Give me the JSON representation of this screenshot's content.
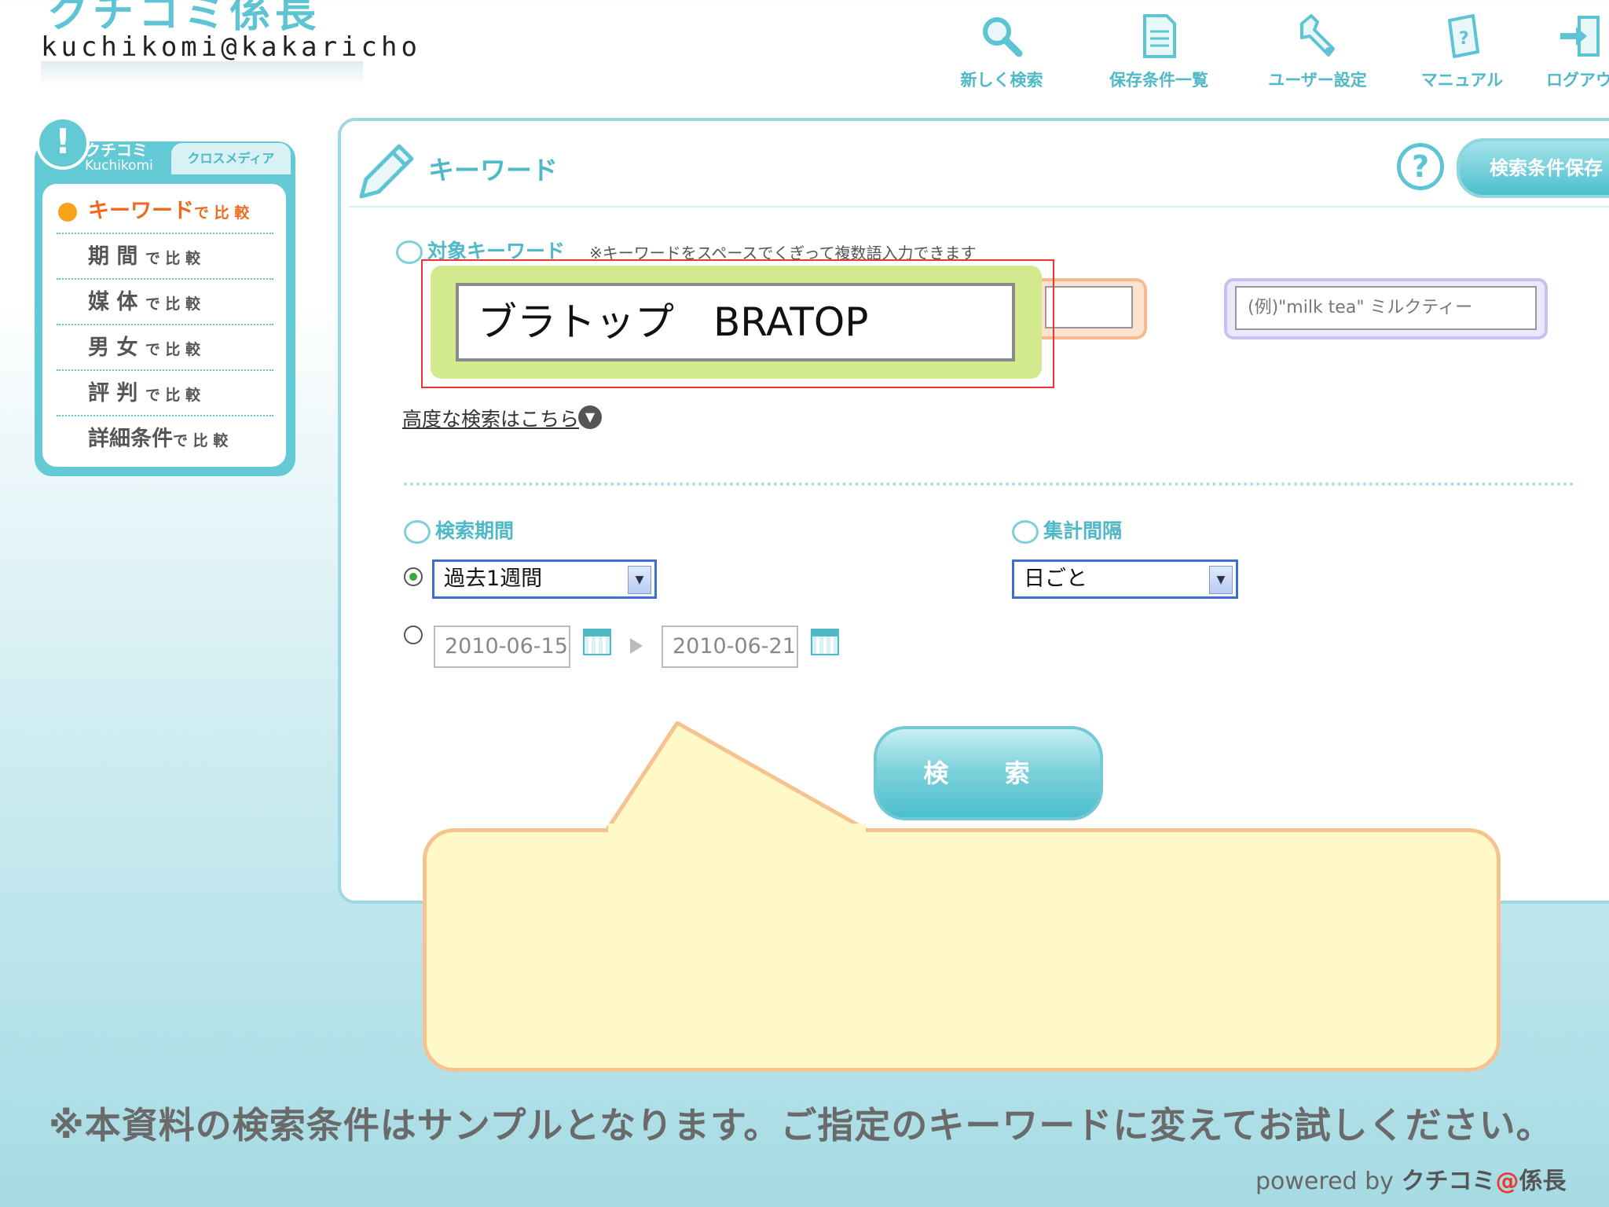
{
  "logo": {
    "title": "クチコミ係長",
    "subtitle": "kuchikomi@kakaricho"
  },
  "nav": [
    {
      "label": "新しく検索",
      "icon": "search-icon"
    },
    {
      "label": "保存条件一覧",
      "icon": "document-icon"
    },
    {
      "label": "ユーザー設定",
      "icon": "wrench-icon"
    },
    {
      "label": "マニュアル",
      "icon": "manual-icon"
    },
    {
      "label": "ログアウ",
      "icon": "logout-icon"
    }
  ],
  "sidebar": {
    "badge": "!",
    "title": "クチコミ",
    "title_en": "Kuchikomi",
    "tab": "クロスメディア",
    "items": [
      {
        "main": "キーワード",
        "suffix": "で 比 較",
        "active": true
      },
      {
        "main": "期 間",
        "suffix": "で 比 較",
        "active": false
      },
      {
        "main": "媒 体",
        "suffix": "で 比 較",
        "active": false
      },
      {
        "main": "男 女",
        "suffix": "で 比 較",
        "active": false
      },
      {
        "main": "評 判",
        "suffix": "で 比 較",
        "active": false
      },
      {
        "main": "詳細条件",
        "suffix": "で 比 較",
        "active": false
      }
    ]
  },
  "panel": {
    "title": "キーワード",
    "help": "?",
    "save_button": "検索条件保存"
  },
  "keyword": {
    "label": "対象キーワード",
    "note": "※キーワードをスペースでくぎって複数語入力できます",
    "value": "ブラトップ　BRATOP",
    "second_value": "",
    "placeholder": "(例)\"milk tea\" ミルクティー"
  },
  "advanced_link": "高度な検索はこちら",
  "period": {
    "label": "検索期間",
    "selected": "過去1週間",
    "start_date": "2010-06-15",
    "end_date": "2010-06-21",
    "preset_radio_checked": true
  },
  "interval": {
    "label": "集計間隔",
    "selected": "日ごと"
  },
  "search_button": "検 索",
  "notice": "※本資料の検索条件はサンプルとなります。ご指定のキーワードに変えてお試しください。",
  "footer": {
    "powered": "powered by",
    "brand_a": "クチコミ",
    "at": "@",
    "brand_b": "係長"
  },
  "colors": {
    "accent": "#4fb9c8",
    "orange": "#f06a1e",
    "highlight_green": "#d3e98d",
    "callout": "#fff8c7"
  }
}
